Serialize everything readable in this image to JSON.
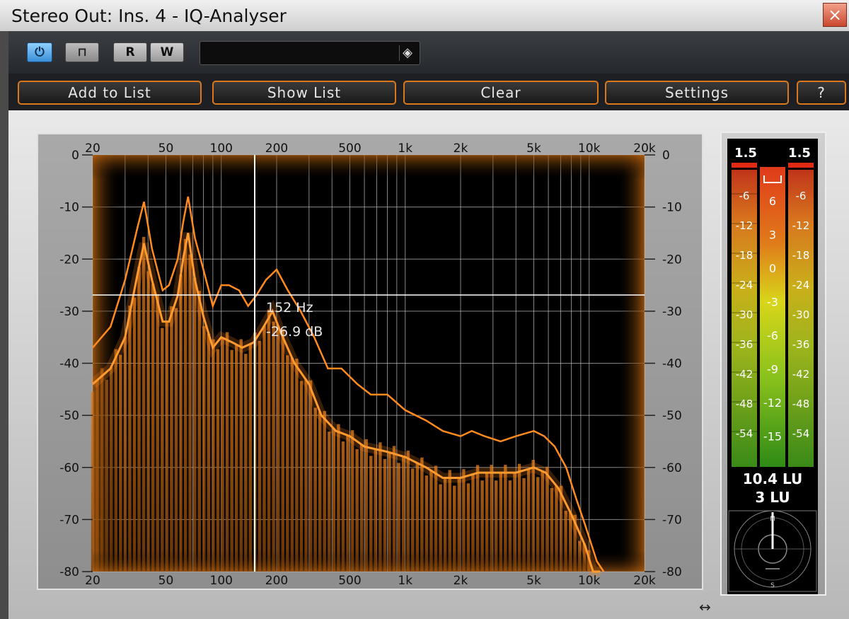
{
  "window": {
    "title": "Stereo Out: Ins. 4 - IQ-Analyser",
    "close_glyph": "×"
  },
  "toolbar": {
    "power_icon": "power-icon",
    "bypass_icon": "bypass-icon",
    "read_label": "R",
    "write_label": "W",
    "preset_value": "",
    "preset_icon": "preset-browser-icon"
  },
  "buttons": {
    "add_to_list": "Add to List",
    "show_list": "Show List",
    "clear": "Clear",
    "settings": "Settings",
    "help": "?"
  },
  "spectrum": {
    "freq_ticks": [
      "20",
      "50",
      "100",
      "200",
      "500",
      "1k",
      "2k",
      "5k",
      "10k",
      "20k"
    ],
    "db_ticks": [
      "0",
      "-10",
      "-20",
      "-30",
      "-40",
      "-50",
      "-60",
      "-70",
      "-80"
    ],
    "cursor": {
      "freq": "152 Hz",
      "level": "-26.9 dB"
    },
    "colors": {
      "accent": "#e07a1a",
      "background": "#000000",
      "grid": "#bfbfbf"
    }
  },
  "meter": {
    "peak_left": "1.5",
    "peak_right": "1.5",
    "side_scale": [
      "-6",
      "-12",
      "-18",
      "-24",
      "-30",
      "-36",
      "-42",
      "-48",
      "-54"
    ],
    "center_scale": [
      "6",
      "3",
      "0",
      "-3",
      "-6",
      "-9",
      "-12",
      "-15"
    ],
    "loudness_1": "10.4 LU",
    "loudness_2": "3 LU",
    "goniometer_labels": {
      "top": "M",
      "bottom": "S"
    }
  },
  "resize_glyph": "↔"
}
